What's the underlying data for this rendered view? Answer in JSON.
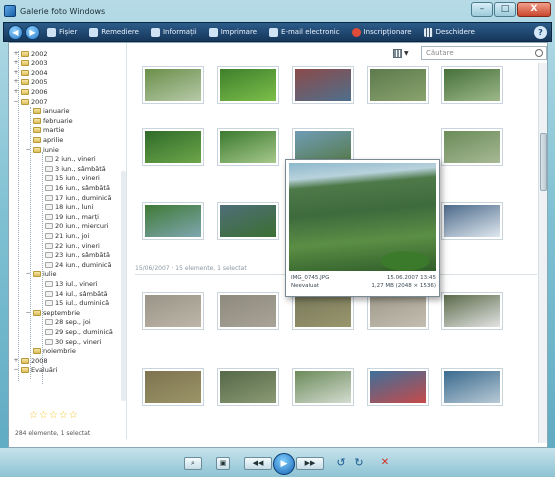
{
  "window": {
    "title": "Galerie foto Windows",
    "controls": {
      "minimize": "–",
      "maximize": "□",
      "close": "X"
    }
  },
  "toolbar": {
    "back": "◀",
    "forward": "▶",
    "items": [
      {
        "label": "Fișier",
        "icon": "file-icon"
      },
      {
        "label": "Remediere",
        "icon": "fix-icon"
      },
      {
        "label": "Informații",
        "icon": "info-icon"
      },
      {
        "label": "Imprimare",
        "icon": "print-icon"
      },
      {
        "label": "E-mail electronic",
        "icon": "email-icon"
      },
      {
        "label": "Inscripționare",
        "icon": "burn-icon"
      },
      {
        "label": "Deschidere",
        "icon": "movie-icon"
      }
    ],
    "help": "?"
  },
  "search": {
    "placeholder": "Căutare"
  },
  "sidebar": {
    "tree": [
      {
        "label": "2002",
        "level": 1,
        "expander": "+"
      },
      {
        "label": "2003",
        "level": 1,
        "expander": "+"
      },
      {
        "label": "2004",
        "level": 1,
        "expander": "+"
      },
      {
        "label": "2005",
        "level": 1,
        "expander": "+"
      },
      {
        "label": "2006",
        "level": 1,
        "expander": "+"
      },
      {
        "label": "2007",
        "level": 1,
        "expander": "−"
      },
      {
        "label": "ianuarie",
        "level": 2,
        "expander": ""
      },
      {
        "label": "februarie",
        "level": 2,
        "expander": ""
      },
      {
        "label": "martie",
        "level": 2,
        "expander": ""
      },
      {
        "label": "aprilie",
        "level": 2,
        "expander": ""
      },
      {
        "label": "iunie",
        "level": 2,
        "expander": "−"
      },
      {
        "label": "2 iun., vineri",
        "level": 3,
        "expander": ""
      },
      {
        "label": "3 iun., sâmbătă",
        "level": 3,
        "expander": ""
      },
      {
        "label": "15 iun., vineri",
        "level": 3,
        "expander": ""
      },
      {
        "label": "16 iun., sâmbătă",
        "level": 3,
        "expander": ""
      },
      {
        "label": "17 iun., duminică",
        "level": 3,
        "expander": ""
      },
      {
        "label": "18 iun., luni",
        "level": 3,
        "expander": ""
      },
      {
        "label": "19 iun., marți",
        "level": 3,
        "expander": ""
      },
      {
        "label": "20 iun., miercuri",
        "level": 3,
        "expander": ""
      },
      {
        "label": "21 iun., joi",
        "level": 3,
        "expander": ""
      },
      {
        "label": "22 iun., vineri",
        "level": 3,
        "expander": ""
      },
      {
        "label": "23 iun., sâmbătă",
        "level": 3,
        "expander": ""
      },
      {
        "label": "24 iun., duminică",
        "level": 3,
        "expander": ""
      },
      {
        "label": "iulie",
        "level": 2,
        "expander": "−"
      },
      {
        "label": "13 iul., vineri",
        "level": 3,
        "expander": ""
      },
      {
        "label": "14 iul., sâmbătă",
        "level": 3,
        "expander": ""
      },
      {
        "label": "15 iul., duminică",
        "level": 3,
        "expander": ""
      },
      {
        "label": "septembrie",
        "level": 2,
        "expander": "−"
      },
      {
        "label": "28 sep., joi",
        "level": 3,
        "expander": ""
      },
      {
        "label": "29 sep., duminică",
        "level": 3,
        "expander": ""
      },
      {
        "label": "30 sep., vineri",
        "level": 3,
        "expander": ""
      },
      {
        "label": "noiembrie",
        "level": 2,
        "expander": ""
      },
      {
        "label": "2008",
        "level": 1,
        "expander": "+"
      },
      {
        "label": "Evaluări",
        "level": 0,
        "expander": "−"
      }
    ],
    "rating_stars": [
      "☆",
      "☆",
      "☆",
      "☆",
      "☆"
    ],
    "status": "284 elemente, 1 selectat"
  },
  "content": {
    "group_header": "15/06/2007 · 15 elemente, 1 selectat",
    "photos": [
      {
        "name": "photo-01",
        "colors": [
          "#6a8f4a",
          "#b7c9a8"
        ]
      },
      {
        "name": "photo-02",
        "colors": [
          "#3e7f2c",
          "#7cbf4a"
        ]
      },
      {
        "name": "photo-03",
        "colors": [
          "#8b4a4a",
          "#4f6f8c"
        ]
      },
      {
        "name": "photo-04",
        "colors": [
          "#5d7a4c",
          "#8aa36e"
        ]
      },
      {
        "name": "photo-05",
        "colors": [
          "#46703a",
          "#9db88a"
        ]
      },
      {
        "name": "photo-06",
        "colors": [
          "#2f6b2a",
          "#6ea64a"
        ]
      },
      {
        "name": "photo-07",
        "colors": [
          "#3b7a30",
          "#a6c88a"
        ]
      },
      {
        "name": "photo-08",
        "colors": [
          "#6f9cb6",
          "#567a4a"
        ]
      },
      {
        "name": "photo-09",
        "colors": [
          "#6a8c58",
          "#a7b895"
        ]
      },
      {
        "name": "photo-10",
        "colors": [
          "#3f7a36",
          "#7fa6b0"
        ]
      },
      {
        "name": "photo-11",
        "colors": [
          "#4e6e78",
          "#3b6f32"
        ]
      },
      {
        "name": "photo-12",
        "colors": [
          "#5b8a9a",
          "#2f5e2a"
        ]
      },
      {
        "name": "photo-13",
        "colors": [
          "#4c6a8a",
          "#dfe8ef"
        ]
      },
      {
        "name": "photo-14",
        "colors": [
          "#9a9488",
          "#bdb6a8"
        ]
      },
      {
        "name": "photo-15",
        "colors": [
          "#8e8a7d",
          "#a9a398"
        ]
      },
      {
        "name": "photo-16",
        "colors": [
          "#7a7a5c",
          "#98966c"
        ]
      },
      {
        "name": "photo-17",
        "colors": [
          "#a09a8c",
          "#c4beb0"
        ]
      },
      {
        "name": "photo-18",
        "colors": [
          "#5b6b4a",
          "#e3e3e3"
        ]
      },
      {
        "name": "photo-19",
        "colors": [
          "#7d7450",
          "#9c9468"
        ]
      },
      {
        "name": "photo-20",
        "colors": [
          "#556848",
          "#8a9a74"
        ]
      },
      {
        "name": "photo-21",
        "colors": [
          "#6b8a5a",
          "#d4dcd0"
        ]
      },
      {
        "name": "photo-22",
        "colors": [
          "#3e6f9a",
          "#c64a4a"
        ]
      },
      {
        "name": "photo-23",
        "colors": [
          "#3a6a8e",
          "#b8cad6"
        ]
      }
    ],
    "preview": {
      "filename": "IMG_0745.JPG",
      "date": "15.06.2007 13:45",
      "rating_text": "Neevaluat",
      "size": "1,27 MB (2048 × 1536)"
    }
  },
  "player": {
    "zoom": "⌕",
    "fit": "▣",
    "prev": "◀◀",
    "play": "▶",
    "next": "▶▶",
    "rotate_ccw": "↺",
    "rotate_cw": "↻",
    "delete": "✕"
  }
}
